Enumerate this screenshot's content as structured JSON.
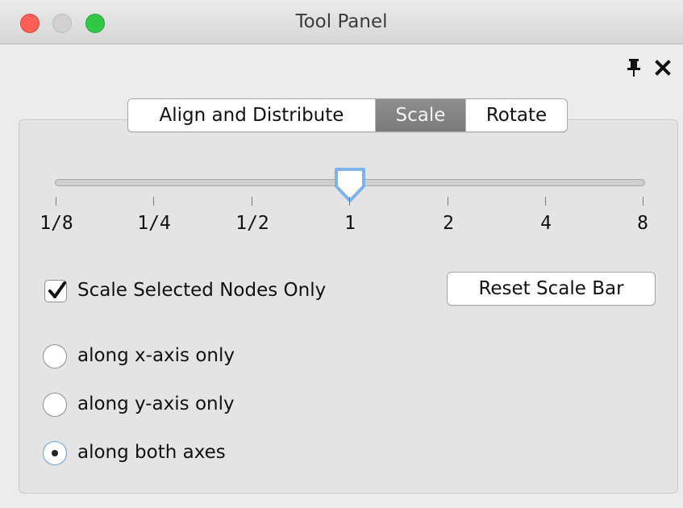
{
  "window": {
    "title": "Tool Panel"
  },
  "tabs": [
    {
      "label": "Align and Distribute",
      "selected": false
    },
    {
      "label": "Scale",
      "selected": true
    },
    {
      "label": "Rotate",
      "selected": false
    }
  ],
  "scale_slider": {
    "value": "1",
    "ticks": [
      "1/8",
      "1/4",
      "1/2",
      "1",
      "2",
      "4",
      "8"
    ]
  },
  "scale_selected_only": {
    "label": "Scale Selected Nodes Only",
    "checked": true
  },
  "reset_button": {
    "label": "Reset Scale Bar"
  },
  "axis_options": {
    "selected": "along both axes",
    "items": [
      {
        "label": "along x-axis only"
      },
      {
        "label": "along y-axis only"
      },
      {
        "label": "along both axes"
      }
    ]
  },
  "colors": {
    "selected_tab": "#858585",
    "accent": "#6b9ed8"
  }
}
